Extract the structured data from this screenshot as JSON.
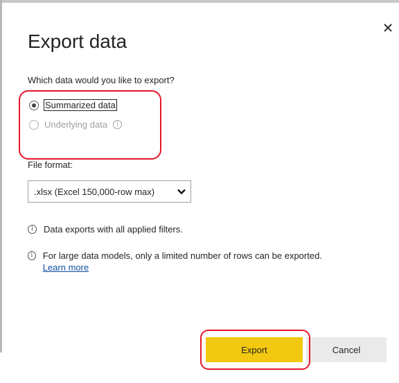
{
  "dialog": {
    "title": "Export data",
    "close_icon": "close-icon",
    "question": "Which data would you like to export?",
    "options": [
      {
        "label": "Summarized data",
        "selected": true,
        "enabled": true
      },
      {
        "label": "Underlying data",
        "selected": false,
        "enabled": false,
        "info_icon": "info-icon"
      }
    ],
    "file_format": {
      "label": "File format:",
      "selected": ".xlsx (Excel 150,000-row max)",
      "icon": "chevron-down-icon"
    },
    "notes": [
      {
        "icon": "info-icon",
        "text": "Data exports with all applied filters."
      },
      {
        "icon": "info-icon",
        "text": "For large data models, only a limited number of rows can be exported.",
        "link": "Learn more"
      }
    ],
    "buttons": {
      "export": "Export",
      "cancel": "Cancel"
    },
    "colors": {
      "primary_button": "#f2c811",
      "secondary_button": "#eaeaea",
      "highlight": "#e3162a",
      "link": "#0e4fa2"
    }
  }
}
